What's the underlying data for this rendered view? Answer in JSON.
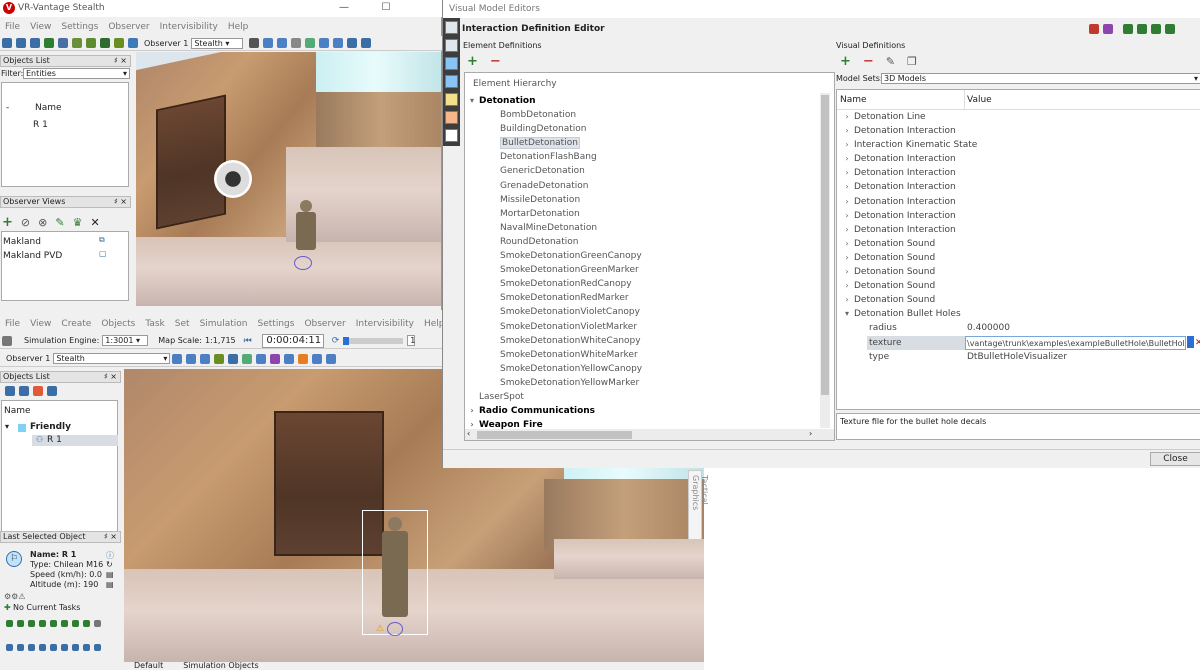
{
  "stealth": {
    "title": "VR-Vantage Stealth",
    "menu": [
      "File",
      "View",
      "Settings",
      "Observer",
      "Intervisibility",
      "Help"
    ],
    "observer_label": "Observer 1",
    "observer_mode": "Stealth",
    "objects_list": {
      "header": "Objects List",
      "filter_label": "Filter:",
      "filter_value": "Entities",
      "col_dash": "-",
      "col_name": "Name",
      "items": [
        "R 1"
      ]
    },
    "observer_views": {
      "header": "Observer Views",
      "items": [
        "Makland",
        "Makland PVD"
      ]
    }
  },
  "simwin": {
    "menu": [
      "File",
      "View",
      "Create",
      "Objects",
      "Task",
      "Set",
      "Simulation",
      "Settings",
      "Observer",
      "Intervisibility",
      "Help"
    ],
    "sim_engine_label": "Simulation Engine:",
    "sim_engine_value": "1:3001",
    "map_scale_label": "Map Scale:",
    "map_scale_value": "1:1,715",
    "clock": "0:00:04:11",
    "speed_value": "1",
    "observer_label": "Observer 1",
    "observer_mode": "Stealth",
    "objects_list": {
      "header": "Objects List",
      "col_name": "Name",
      "group": "Friendly",
      "items": [
        "R 1"
      ]
    },
    "last_selected": {
      "header": "Last Selected Object",
      "name": "Name: R 1",
      "type": "Type: Chilean M16",
      "speed": "Speed (km/h): 0.0",
      "altitude": "Altitude (m): 190",
      "tasks": "No Current Tasks"
    },
    "tabs": [
      "Default",
      "Simulation Objects"
    ],
    "side_tab": "Tactical Graphics"
  },
  "vme": {
    "title": "Visual Model Editors",
    "editor_title": "Interaction Definition Editor",
    "element_definitions": {
      "header": "Element Definitions",
      "hierarchy_label": "Element Hierarchy",
      "root": "Detonation",
      "selected": "BulletDetonation",
      "children": [
        "BombDetonation",
        "BuildingDetonation",
        "BulletDetonation",
        "DetonationFlashBang",
        "GenericDetonation",
        "GrenadeDetonation",
        "MissileDetonation",
        "MortarDetonation",
        "NavalMineDetonation",
        "RoundDetonation",
        "SmokeDetonationGreenCanopy",
        "SmokeDetonationGreenMarker",
        "SmokeDetonationRedCanopy",
        "SmokeDetonationRedMarker",
        "SmokeDetonationVioletCanopy",
        "SmokeDetonationVioletMarker",
        "SmokeDetonationWhiteCanopy",
        "SmokeDetonationWhiteMarker",
        "SmokeDetonationYellowCanopy",
        "SmokeDetonationYellowMarker"
      ],
      "siblings": [
        {
          "label": "LaserSpot",
          "bold": false,
          "expandable": false
        },
        {
          "label": "Radio Communications",
          "bold": true,
          "expandable": true
        },
        {
          "label": "Weapon Fire",
          "bold": true,
          "expandable": true
        }
      ]
    },
    "visual_definitions": {
      "header": "Visual Definitions",
      "model_sets_label": "Model Sets:",
      "model_sets_value": "3D Models",
      "col_name": "Name",
      "col_value": "Value",
      "rows": [
        "Detonation Line",
        "Detonation Interaction",
        "Interaction Kinematic State",
        "Detonation Interaction",
        "Detonation Interaction",
        "Detonation Interaction",
        "Detonation Interaction",
        "Detonation Interaction",
        "Detonation Interaction",
        "Detonation Sound",
        "Detonation Sound",
        "Detonation Sound",
        "Detonation Sound",
        "Detonation Sound"
      ],
      "expanded_row": "Detonation Bullet Holes",
      "properties": [
        {
          "name": "radius",
          "value": "0.400000"
        },
        {
          "name": "texture",
          "value": "\\vantage\\trunk\\examples\\exampleBulletHole\\BulletHole.png"
        },
        {
          "name": "type",
          "value": "DtBulletHoleVisualizer"
        }
      ],
      "description": "Texture file for the bullet hole decals"
    },
    "close_label": "Close"
  }
}
